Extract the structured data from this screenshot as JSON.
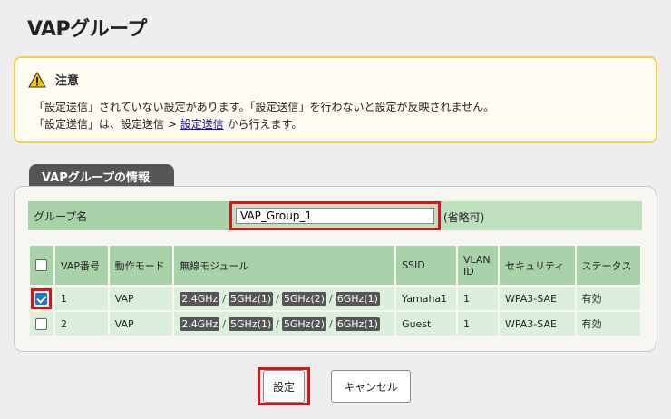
{
  "page": {
    "title": "VAPグループ"
  },
  "notice": {
    "title": "注意",
    "line1": "「設定送信」されていない設定があります。「設定送信」を行わないと設定が反映されません。",
    "line2_prefix": "「設定送信」は、設定送信 > ",
    "line2_link": "設定送信",
    "line2_suffix": " から行えます。",
    "icon": "warning-icon",
    "accent_color": "#f2cf52"
  },
  "section": {
    "tab_label": "VAPグループの情報",
    "group_name_label": "グループ名",
    "group_name_value": "VAP_Group_1",
    "optional_label": "(省略可)"
  },
  "table": {
    "headers": {
      "vap_no": "VAP番号",
      "mode": "動作モード",
      "module": "無線モジュール",
      "ssid": "SSID",
      "vlan_id": "VLAN ID",
      "security": "セキュリティ",
      "status": "ステータス"
    },
    "rows": [
      {
        "checked": true,
        "vap_no": "1",
        "mode": "VAP",
        "modules": [
          "2.4GHz",
          "5GHz(1)",
          "5GHz(2)",
          "6GHz(1)"
        ],
        "ssid": "Yamaha1",
        "vlan_id": "1",
        "security": "WPA3-SAE",
        "status": "有効"
      },
      {
        "checked": false,
        "vap_no": "2",
        "mode": "VAP",
        "modules": [
          "2.4GHz",
          "5GHz(1)",
          "5GHz(2)",
          "6GHz(1)"
        ],
        "ssid": "Guest",
        "vlan_id": "1",
        "security": "WPA3-SAE",
        "status": "有効"
      }
    ],
    "separator": "/"
  },
  "buttons": {
    "set": "設定",
    "cancel": "キャンセル"
  },
  "colors": {
    "highlight": "#d0191e",
    "header_green": "#a8d2a8",
    "row_green": "#dcefdc"
  }
}
